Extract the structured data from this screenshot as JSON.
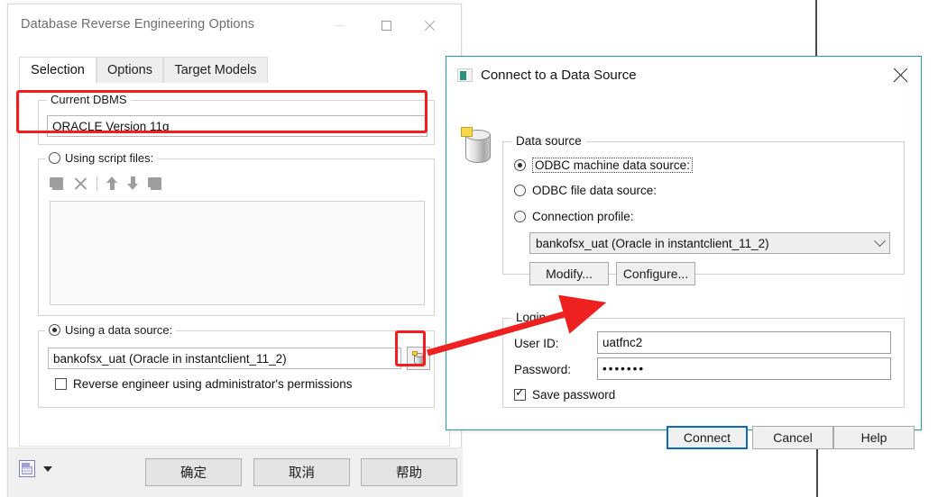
{
  "background": {
    "rule_note": "vertical guide lines"
  },
  "left_dialog": {
    "title": "Database Reverse Engineering Options",
    "window_buttons": {
      "minimize": "minimize-icon",
      "maximize": "maximize-icon",
      "close": "close-icon"
    },
    "tabs": [
      {
        "label": "Selection",
        "active": true
      },
      {
        "label": "Options",
        "active": false
      },
      {
        "label": "Target Models",
        "active": false
      }
    ],
    "current_dbms": {
      "group_label": "Current DBMS",
      "value": "ORACLE Version 11g",
      "highlighted": true,
      "highlight_color": "#f41c1c"
    },
    "script_files": {
      "group_label": "Using script files:",
      "selected": false,
      "toolbar_icons": [
        "add-script-icon",
        "delete-icon",
        "move-up-icon",
        "move-down-icon",
        "edit-script-icon"
      ],
      "list_items": []
    },
    "data_source": {
      "group_label": "Using a data source:",
      "selected": true,
      "value": "bankofsx_uat (Oracle in instantclient_11_2)",
      "picker_icon": "database-source-icon",
      "picker_highlighted": true,
      "admin_checkbox": {
        "label": "Reverse engineer using administrator's permissions",
        "checked": false
      }
    },
    "footer": {
      "save_icon": "save-settings-icon",
      "dropdown_icon": "chevron-down-icon",
      "buttons": [
        {
          "label": "确定",
          "name": "ok"
        },
        {
          "label": "取消",
          "name": "cancel"
        },
        {
          "label": "帮助",
          "name": "help"
        }
      ]
    }
  },
  "right_dialog": {
    "title": "Connect to a Data Source",
    "app_icon": "data-source-icon",
    "close_icon": "close-icon",
    "side_icon": "database-cylinder-icon",
    "data_source": {
      "group_label": "Data source",
      "options": [
        {
          "label": "ODBC machine data source:",
          "selected": true,
          "focused": true
        },
        {
          "label": "ODBC file data source:",
          "selected": false,
          "focused": false
        },
        {
          "label": "Connection profile:",
          "selected": false,
          "focused": false
        }
      ],
      "combo_value": "bankofsx_uat (Oracle in instantclient_11_2)",
      "combo_icon": "chevron-down-icon",
      "modify_button": "Modify...",
      "configure_button": "Configure..."
    },
    "login": {
      "group_label": "Login",
      "user_id_label": "User ID:",
      "user_id_value": "uatfnc2",
      "password_label": "Password:",
      "password_value": "•••••••",
      "save_password_label": "Save password",
      "save_password_checked": true
    },
    "buttons": [
      {
        "label": "Connect",
        "name": "connect",
        "default": true
      },
      {
        "label": "Cancel",
        "name": "cancel",
        "default": false
      },
      {
        "label": "Help",
        "name": "help",
        "default": false
      }
    ]
  },
  "annotations": {
    "arrow_color": "#ef2020",
    "arrow_description": "red arrow from data source picker button to Password field"
  }
}
